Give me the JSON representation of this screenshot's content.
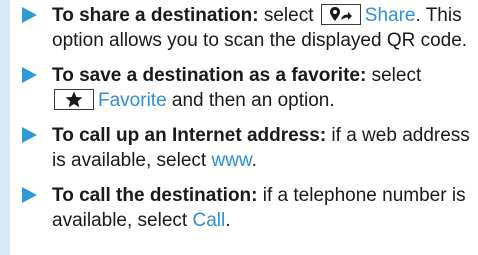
{
  "items": [
    {
      "lead": "To share a destination:",
      "text_before": " select ",
      "icon": "share-destination-icon",
      "link": "Share",
      "text_after": ". This option allows you to scan the displayed QR code."
    },
    {
      "lead": "To save a destination as a favorite:",
      "text_before": " select ",
      "icon": "star-icon",
      "link": "Favorite",
      "text_after": " and then an option."
    },
    {
      "lead": "To call up an Internet address:",
      "text_before": " if a web address is available, select ",
      "link": "www",
      "text_after": "."
    },
    {
      "lead": "To call the destination:",
      "text_before": " if a telephone number is available, select ",
      "link": "Call",
      "text_after": "."
    }
  ],
  "colors": {
    "accent": "#2f9bd6",
    "link": "#2f8fd1",
    "strip": "#d6e9f5",
    "text": "#1a1a1a"
  }
}
